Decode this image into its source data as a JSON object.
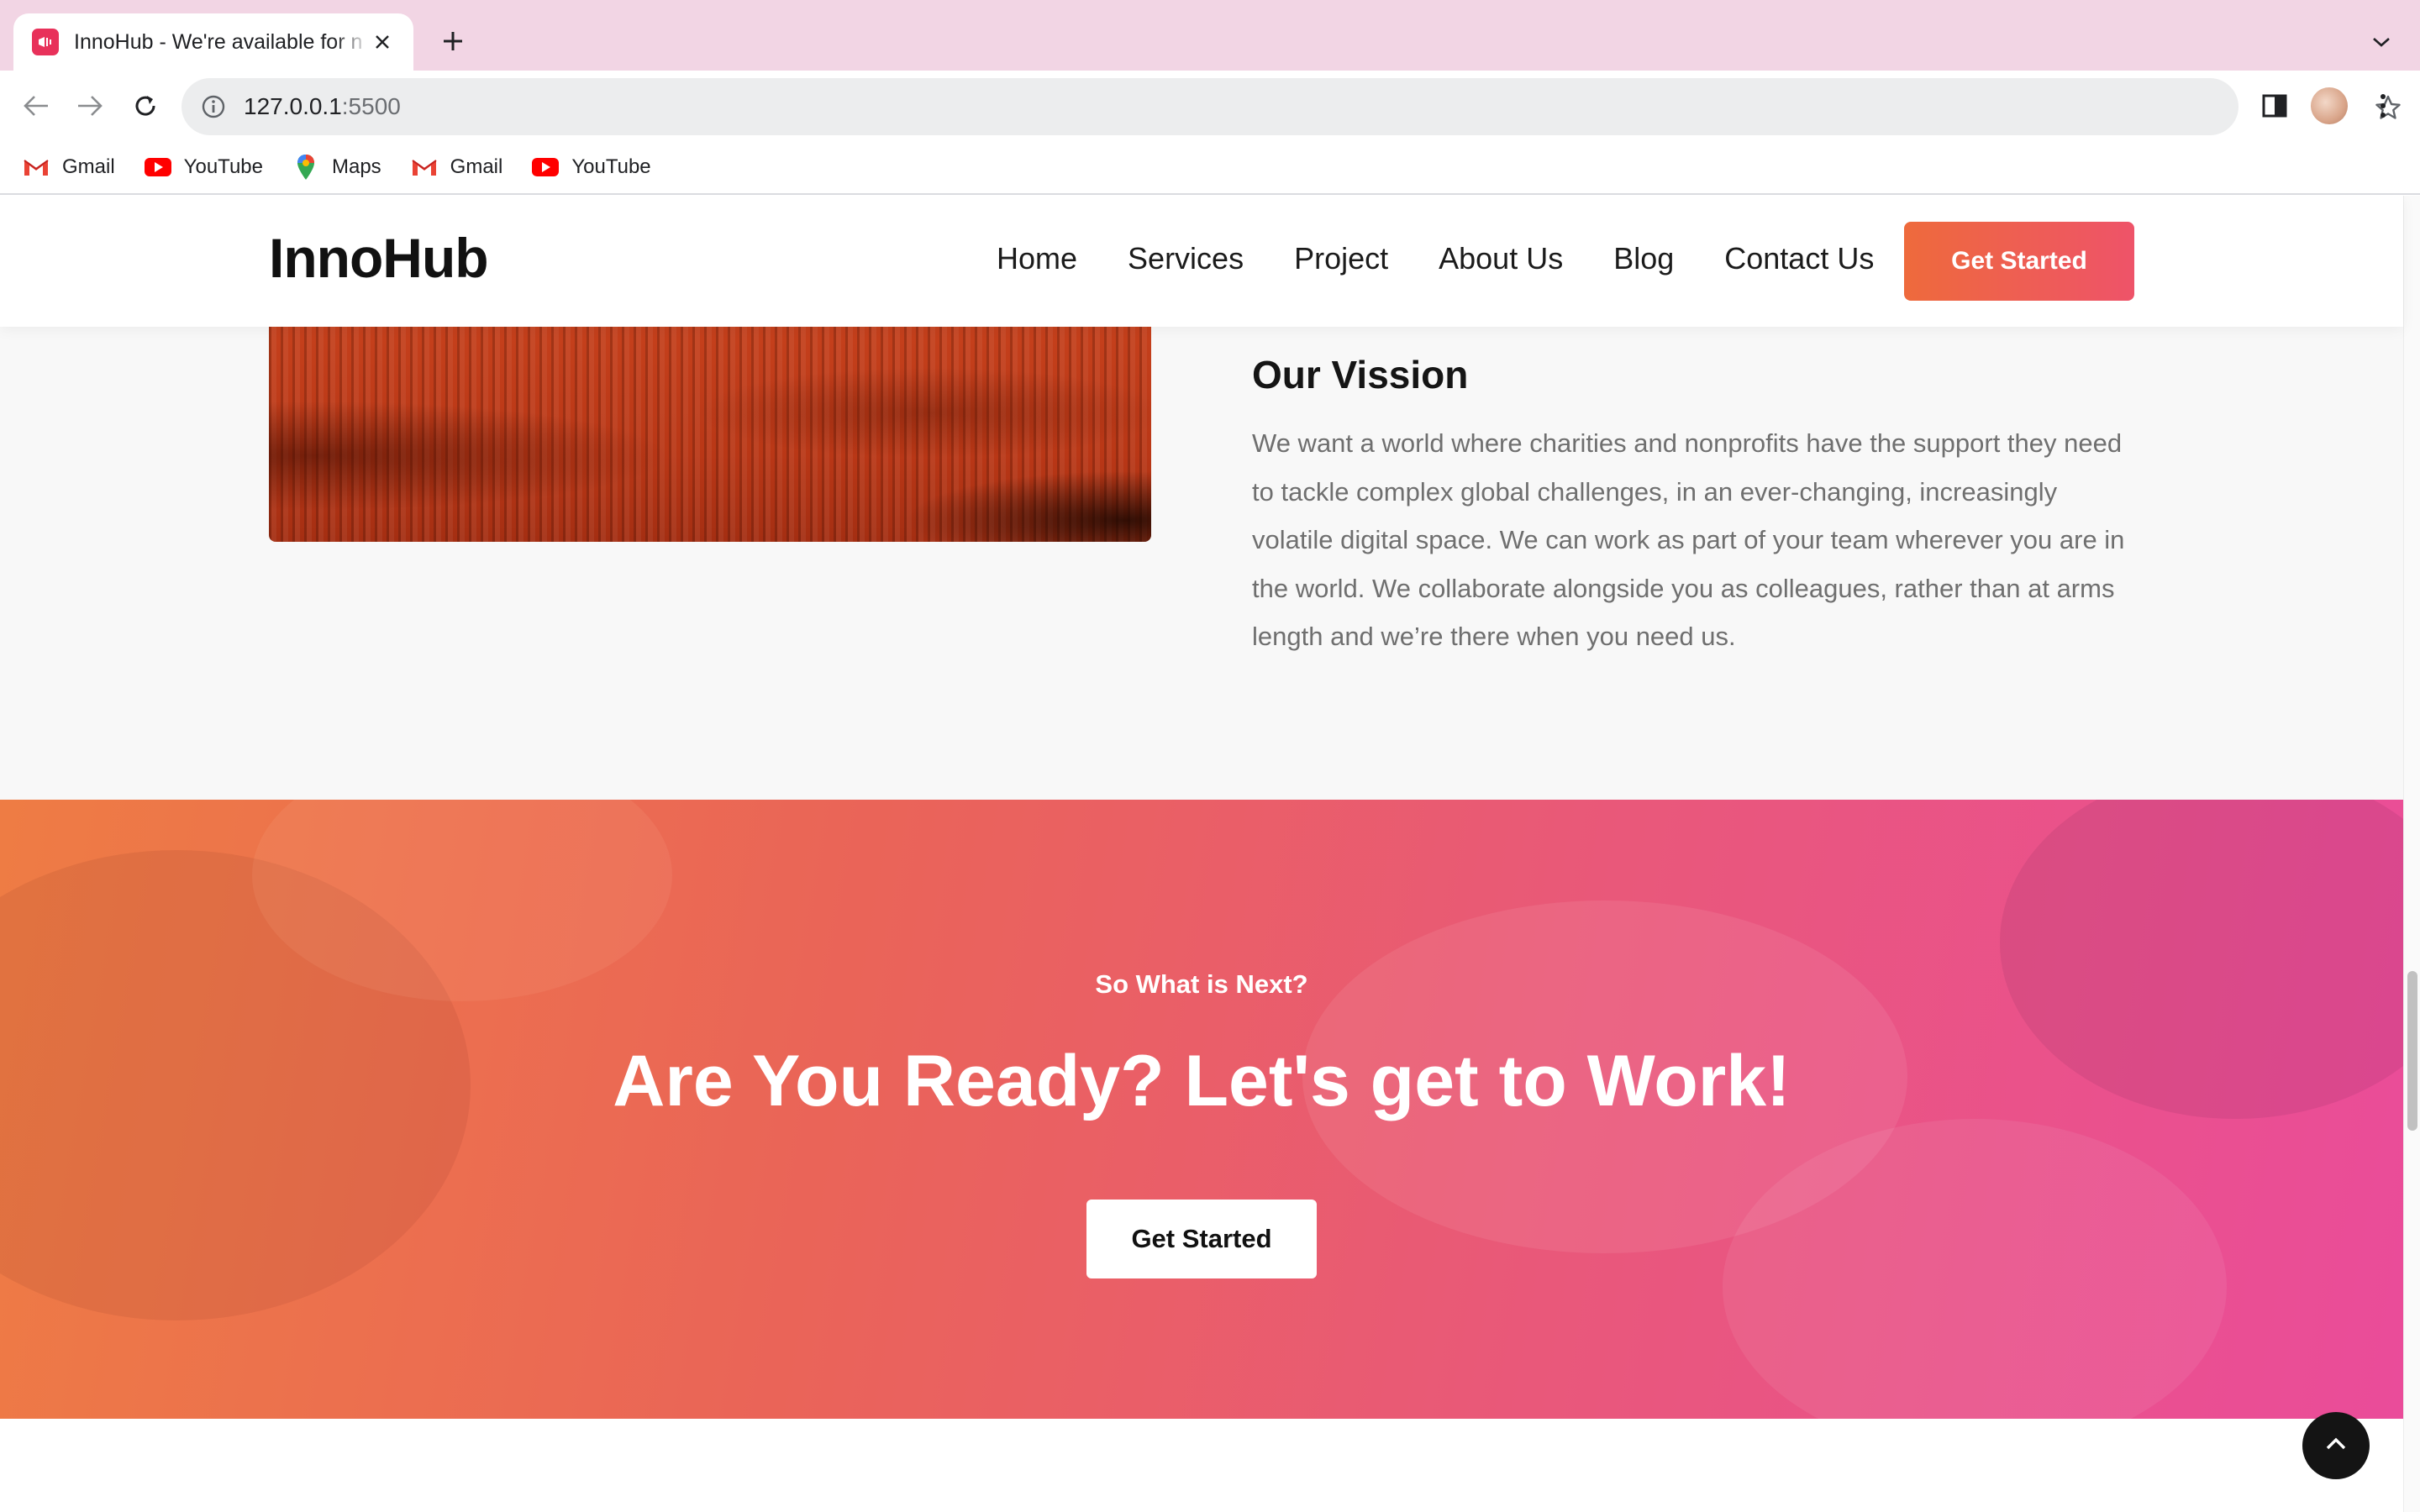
{
  "browser": {
    "tab_title": "InnoHub - We're available for n",
    "url_host": "127.0.0.1",
    "url_port": ":5500",
    "bookmarks": [
      {
        "label": "Gmail",
        "icon": "gmail-icon"
      },
      {
        "label": "YouTube",
        "icon": "youtube-icon"
      },
      {
        "label": "Maps",
        "icon": "maps-icon"
      },
      {
        "label": "Gmail",
        "icon": "gmail-icon"
      },
      {
        "label": "YouTube",
        "icon": "youtube-icon"
      }
    ]
  },
  "header": {
    "logo": "InnoHub",
    "nav": [
      "Home",
      "Services",
      "Project",
      "About Us",
      "Blog",
      "Contact Us"
    ],
    "cta": "Get Started"
  },
  "vision": {
    "title": "Our Vission",
    "text": "We want a world where charities and nonprofits have the support they need to tackle complex global challenges, in an ever-changing, increasingly volatile digital space. We can work as part of your team wherever you are in the world. We collaborate alongside you as colleagues, rather than at arms length and we’re there when you need us."
  },
  "cta_section": {
    "kicker": "So What is Next?",
    "heading": "Are You Ready? Let's get to Work!",
    "button": "Get Started"
  },
  "colors": {
    "tabbar": "#f2d5e4",
    "accent_orange": "#ee6a3c",
    "accent_pink": "#ea4c9a",
    "dark": "#141414"
  }
}
